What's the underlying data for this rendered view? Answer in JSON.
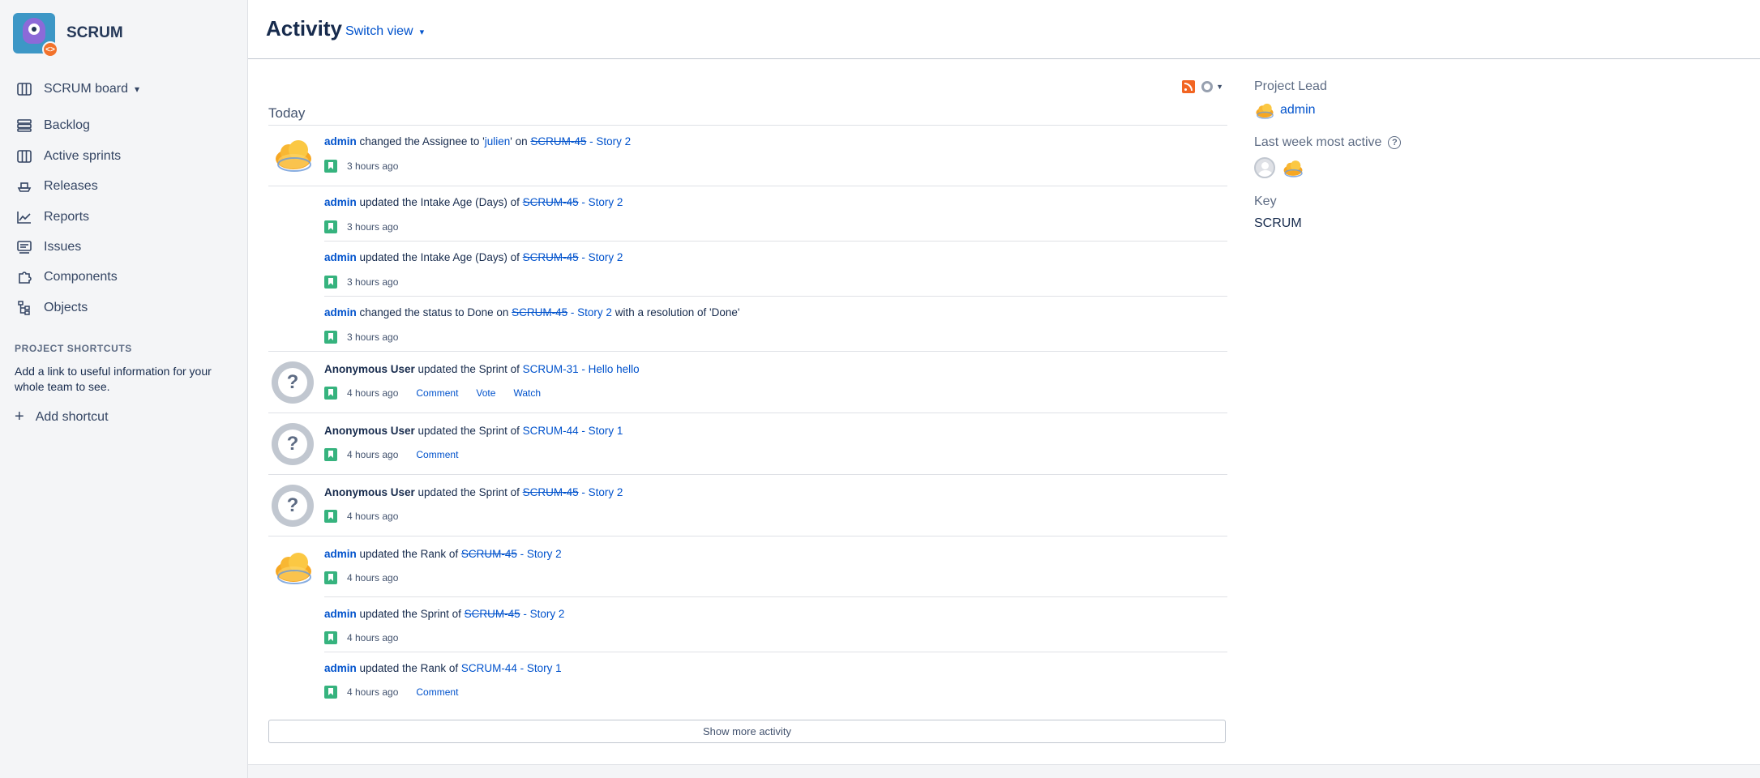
{
  "sidebar": {
    "project_name": "SCRUM",
    "board_label": "SCRUM board",
    "items": [
      {
        "label": "Backlog"
      },
      {
        "label": "Active sprints"
      },
      {
        "label": "Releases"
      },
      {
        "label": "Reports"
      },
      {
        "label": "Issues"
      },
      {
        "label": "Components"
      },
      {
        "label": "Objects"
      }
    ],
    "shortcuts_title": "PROJECT SHORTCUTS",
    "shortcuts_text": "Add a link to useful information for your whole team to see.",
    "add_shortcut": "Add shortcut"
  },
  "header": {
    "title": "Activity",
    "switch_view": "Switch view"
  },
  "stream": {
    "day": "Today",
    "entries": [
      {
        "user": "admin",
        "pre": " changed the Assignee to '",
        "assignee": "julien",
        "mid": "' on ",
        "key": "SCRUM-45",
        "summary": " - Story 2",
        "post": "",
        "time": "3 hours ago"
      },
      {
        "user": "admin",
        "pre": " updated the Intake Age (Days) of ",
        "key": "SCRUM-45",
        "summary": " - Story 2",
        "time": "3 hours ago"
      },
      {
        "user": "admin",
        "pre": " updated the Intake Age (Days) of ",
        "key": "SCRUM-45",
        "summary": " - Story 2",
        "time": "3 hours ago"
      },
      {
        "user": "admin",
        "pre": " changed the status to Done on ",
        "key": "SCRUM-45",
        "summary": " - Story 2",
        "post": " with a resolution of 'Done'",
        "time": "3 hours ago"
      },
      {
        "user": "Anonymous User",
        "pre": " updated the Sprint of ",
        "key_summary": "SCRUM-31 - Hello hello",
        "time": "4 hours ago",
        "actions": [
          "Comment",
          "Vote",
          "Watch"
        ]
      },
      {
        "user": "Anonymous User",
        "pre": " updated the Sprint of ",
        "key_summary": "SCRUM-44 - Story 1",
        "time": "4 hours ago",
        "actions": [
          "Comment"
        ]
      },
      {
        "user": "Anonymous User",
        "pre": " updated the Sprint of ",
        "key": "SCRUM-45",
        "summary": " - Story 2",
        "time": "4 hours ago"
      },
      {
        "user": "admin",
        "pre": " updated the Rank of ",
        "key": "SCRUM-45",
        "summary": " - Story 2",
        "time": "4 hours ago"
      },
      {
        "user": "admin",
        "pre": " updated the Sprint of ",
        "key": "SCRUM-45",
        "summary": " - Story 2",
        "time": "4 hours ago"
      },
      {
        "user": "admin",
        "pre": " updated the Rank of ",
        "key_summary": "SCRUM-44 - Story 1",
        "time": "4 hours ago",
        "actions": [
          "Comment"
        ]
      }
    ],
    "show_more": "Show more activity"
  },
  "side_panel": {
    "project_lead_label": "Project Lead",
    "project_lead": "admin",
    "most_active_label": "Last week most active",
    "key_label": "Key",
    "key_value": "SCRUM"
  },
  "colors": {
    "link": "#0052cc",
    "sidebar_bg": "#f4f5f7",
    "story_icon": "#36b37e",
    "rss": "#f26522"
  }
}
